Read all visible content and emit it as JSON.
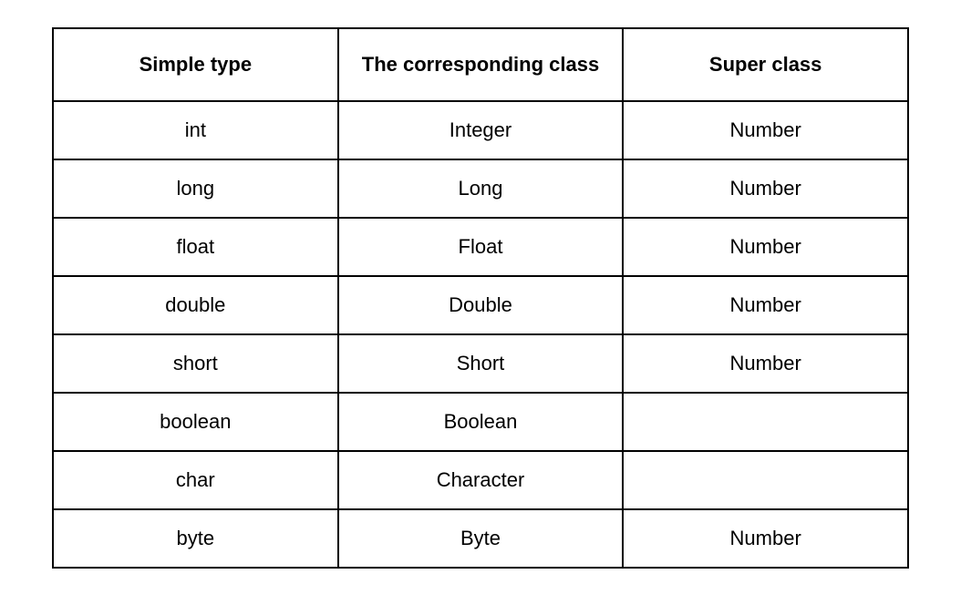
{
  "chart_data": {
    "type": "table",
    "headers": [
      "Simple type",
      "The corresponding class",
      "Super class"
    ],
    "rows": [
      {
        "simple_type": "int",
        "corresponding_class": "Integer",
        "super_class": "Number"
      },
      {
        "simple_type": "long",
        "corresponding_class": "Long",
        "super_class": "Number"
      },
      {
        "simple_type": "float",
        "corresponding_class": "Float",
        "super_class": "Number"
      },
      {
        "simple_type": "double",
        "corresponding_class": "Double",
        "super_class": "Number"
      },
      {
        "simple_type": "short",
        "corresponding_class": "Short",
        "super_class": "Number"
      },
      {
        "simple_type": "boolean",
        "corresponding_class": "Boolean",
        "super_class": ""
      },
      {
        "simple_type": "char",
        "corresponding_class": "Character",
        "super_class": ""
      },
      {
        "simple_type": "byte",
        "corresponding_class": "Byte",
        "super_class": "Number"
      }
    ]
  }
}
